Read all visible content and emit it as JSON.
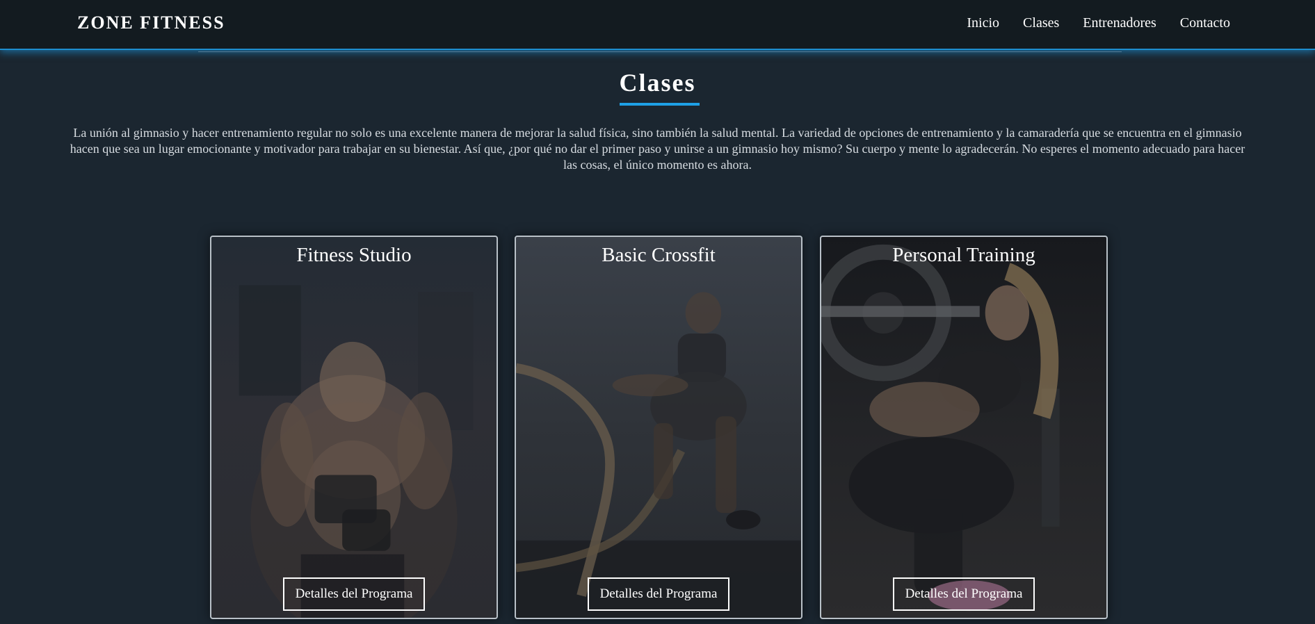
{
  "header": {
    "brand": "ZONE FITNESS",
    "nav": [
      "Inicio",
      "Clases",
      "Entrenadores",
      "Contacto"
    ]
  },
  "section": {
    "title": "Clases",
    "intro": "La unión al gimnasio y hacer entrenamiento regular no solo es una excelente manera de mejorar la salud física, sino también la salud mental. La variedad de opciones de entrenamiento y la camaradería que se encuentra en el gimnasio hacen que sea un lugar emocionante y motivador para trabajar en su bienestar. Así que, ¿por qué no dar el primer paso y unirse a un gimnasio hoy mismo? Su cuerpo y mente lo agradecerán. No esperes el momento adecuado para hacer las cosas, el único momento es ahora."
  },
  "cards": [
    {
      "title": "Fitness Studio",
      "button": "Detalles del Programa"
    },
    {
      "title": "Basic Crossfit",
      "button": "Detalles del Programa"
    },
    {
      "title": "Personal Training",
      "button": "Detalles del Programa"
    }
  ],
  "colors": {
    "accent": "#1ea0e6",
    "navbar": "#131b20",
    "background": "#1b2630"
  }
}
